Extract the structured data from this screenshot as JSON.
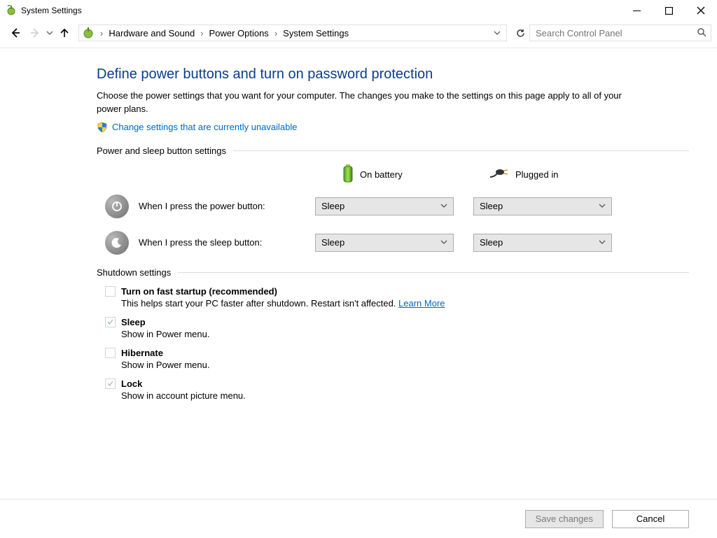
{
  "window": {
    "title": "System Settings"
  },
  "breadcrumb": {
    "item1": "Hardware and Sound",
    "item2": "Power Options",
    "item3": "System Settings"
  },
  "search": {
    "placeholder": "Search Control Panel"
  },
  "page": {
    "heading": "Define power buttons and turn on password protection",
    "description": "Choose the power settings that you want for your computer. The changes you make to the settings on this page apply to all of your power plans.",
    "change_link": "Change settings that are currently unavailable"
  },
  "sections": {
    "power_sleep": "Power and sleep button settings",
    "shutdown": "Shutdown settings"
  },
  "columns": {
    "battery": "On battery",
    "plugged": "Plugged in"
  },
  "rows": {
    "power_button": {
      "label": "When I press the power button:",
      "battery": "Sleep",
      "plugged": "Sleep"
    },
    "sleep_button": {
      "label": "When I press the sleep button:",
      "battery": "Sleep",
      "plugged": "Sleep"
    }
  },
  "shutdown": {
    "fast": {
      "label": "Turn on fast startup (recommended)",
      "sub": "This helps start your PC faster after shutdown. Restart isn't affected. ",
      "learn": "Learn More"
    },
    "sleep": {
      "label": "Sleep",
      "sub": "Show in Power menu."
    },
    "hibernate": {
      "label": "Hibernate",
      "sub": "Show in Power menu."
    },
    "lock": {
      "label": "Lock",
      "sub": "Show in account picture menu."
    }
  },
  "footer": {
    "save": "Save changes",
    "cancel": "Cancel"
  }
}
